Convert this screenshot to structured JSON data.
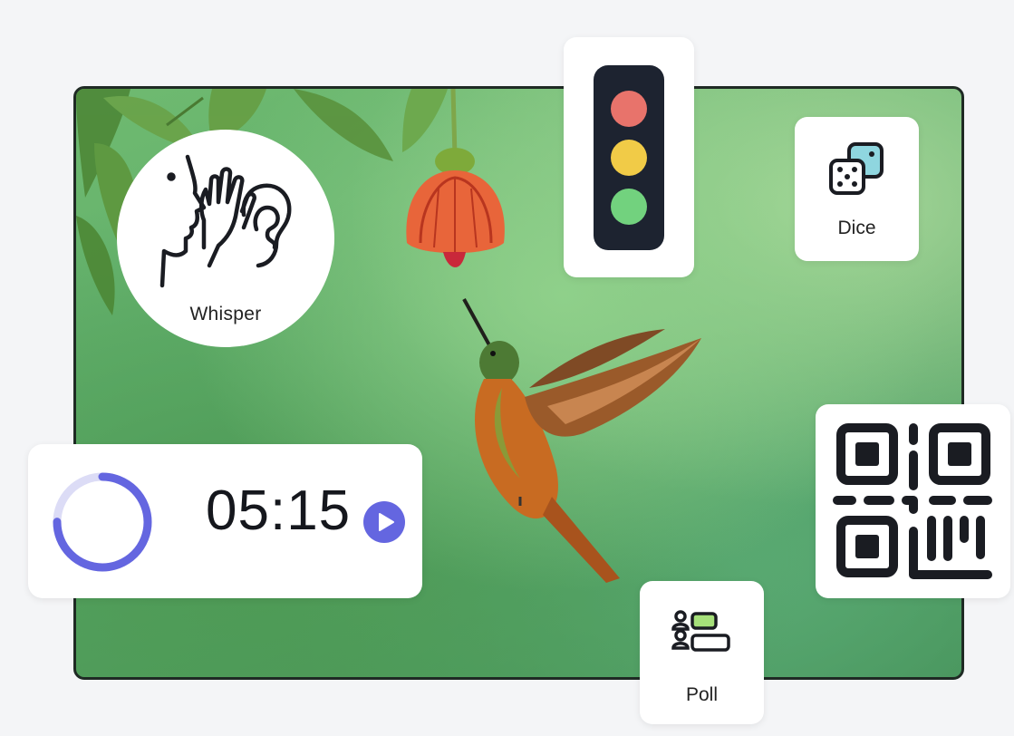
{
  "widgets": {
    "whisper": {
      "label": "Whisper",
      "icon": "whisper-icon"
    },
    "traffic_light": {
      "icon": "traffic-light-icon",
      "colors": {
        "red": "#e8736b",
        "yellow": "#f1cb47",
        "green": "#72d27e",
        "housing": "#1d2330"
      }
    },
    "dice": {
      "label": "Dice",
      "icon": "dice-icon",
      "accent": "#8fd6df"
    },
    "qr_code": {
      "icon": "qr-code-icon"
    },
    "timer": {
      "time": "05:15",
      "progress": 0.75,
      "ring_color": "#6466e0",
      "track_color": "#dcdcf6",
      "play_icon": "play-icon"
    },
    "poll": {
      "label": "Poll",
      "icon": "poll-icon",
      "accent": "#a6e07a"
    }
  },
  "background": {
    "subject": "hummingbird-photo"
  }
}
